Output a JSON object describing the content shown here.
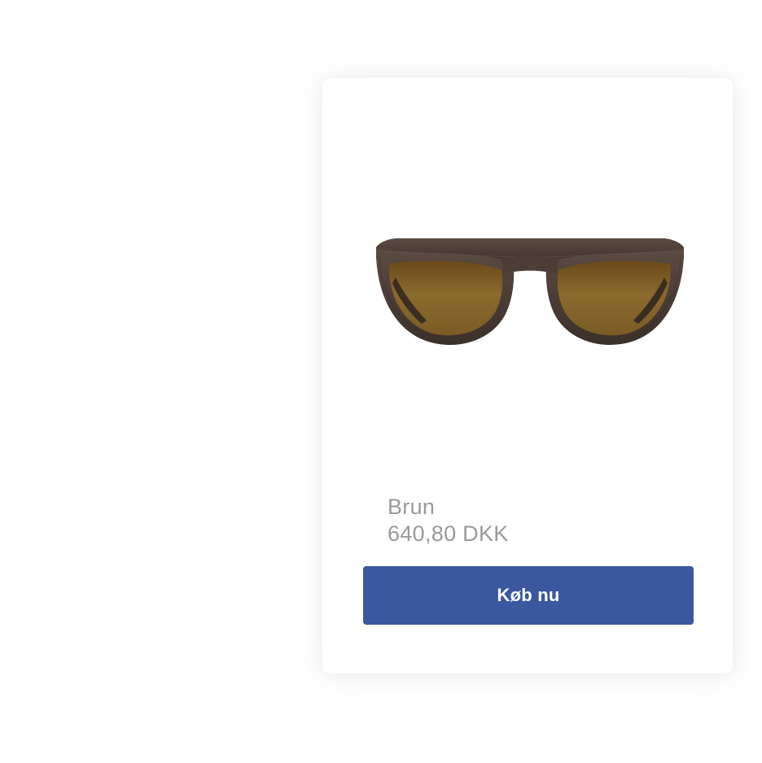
{
  "product": {
    "variant": "Brun",
    "price": "640,80 DKK",
    "image_icon": "sunglasses-image"
  },
  "actions": {
    "buy_label": "Køb nu"
  },
  "colors": {
    "button": "#3b57a0",
    "text_muted": "#9a9a9a",
    "frame": "#4a3c34",
    "lens": "#7a5a22"
  }
}
